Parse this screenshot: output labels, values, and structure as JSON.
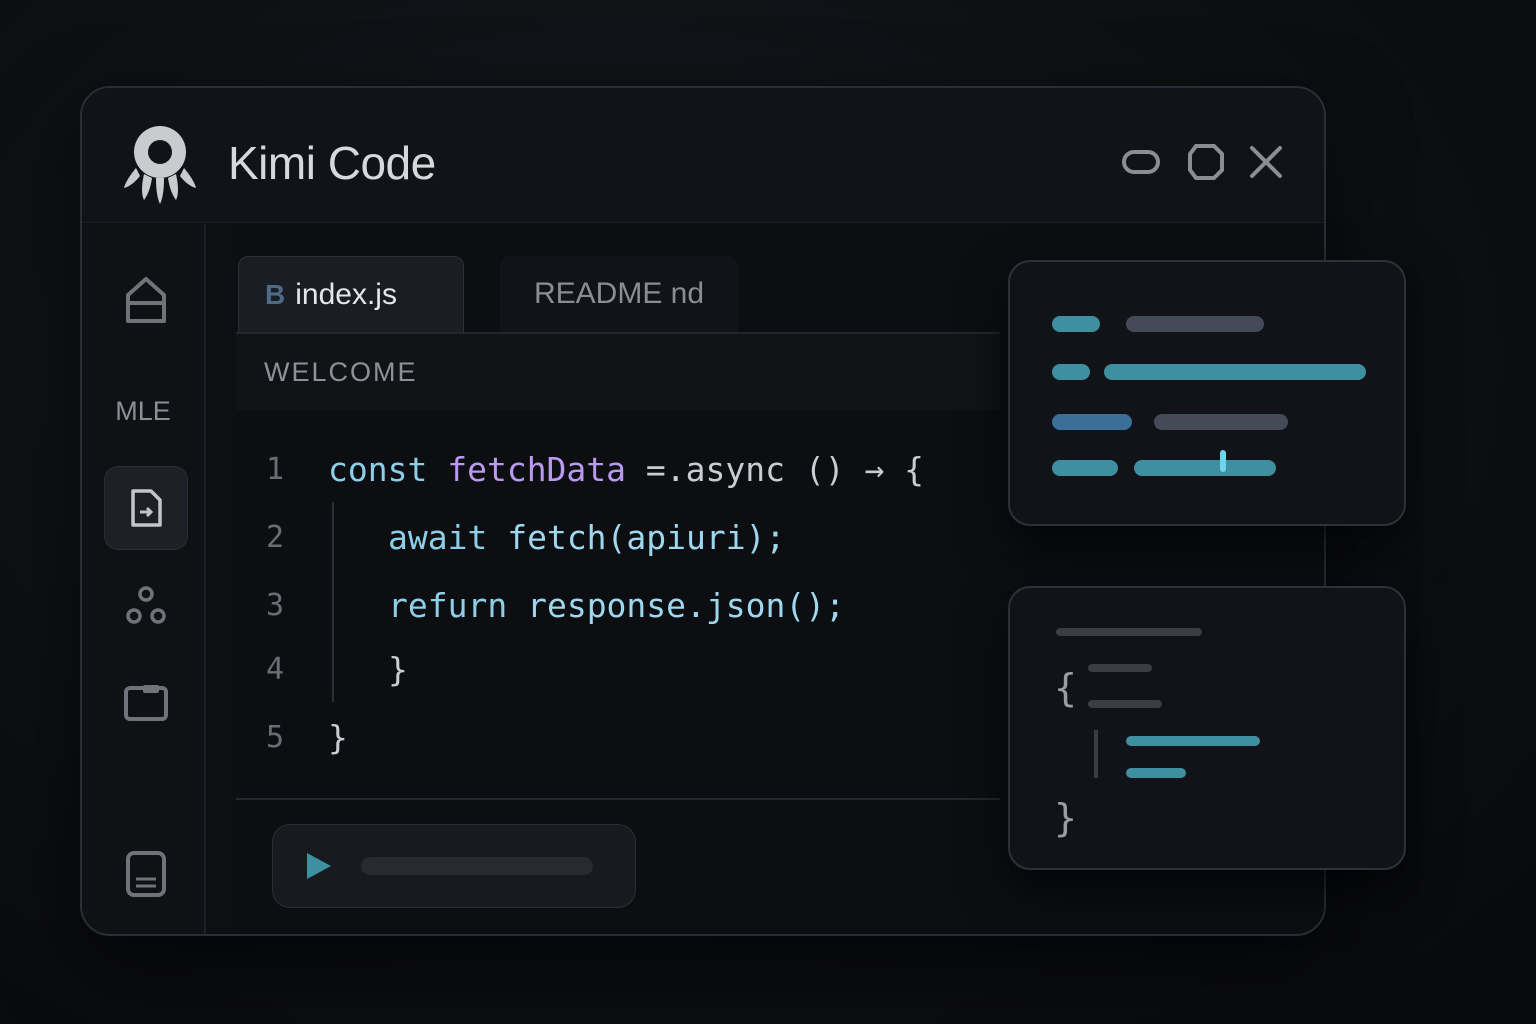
{
  "app": {
    "title": "Kimi Code"
  },
  "sidebar": {
    "label": "MLE"
  },
  "tabs": [
    {
      "label": "index.js",
      "icon": "B",
      "active": true
    },
    {
      "label": "README nd",
      "active": false
    }
  ],
  "section": {
    "header": "WELCOME"
  },
  "code": {
    "line_numbers": [
      "1",
      "2",
      "3",
      "4",
      "5"
    ],
    "line1": {
      "kw": "const",
      "fn": "fetchData",
      "rest": " =.async () → {"
    },
    "line2": {
      "kw": "await",
      "rest": " fetch(apiuri);"
    },
    "line3": {
      "kw": "refurn",
      "rest": " response.json();"
    },
    "line4": {
      "text": "}"
    },
    "line5": {
      "text": "}"
    }
  },
  "json_panel": {
    "open_brace": "{",
    "close_brace": "}"
  },
  "colors": {
    "accent": "#3e8fa0",
    "keyword": "#8ecfe8",
    "function": "#b99aef",
    "background": "#0c0e12"
  }
}
